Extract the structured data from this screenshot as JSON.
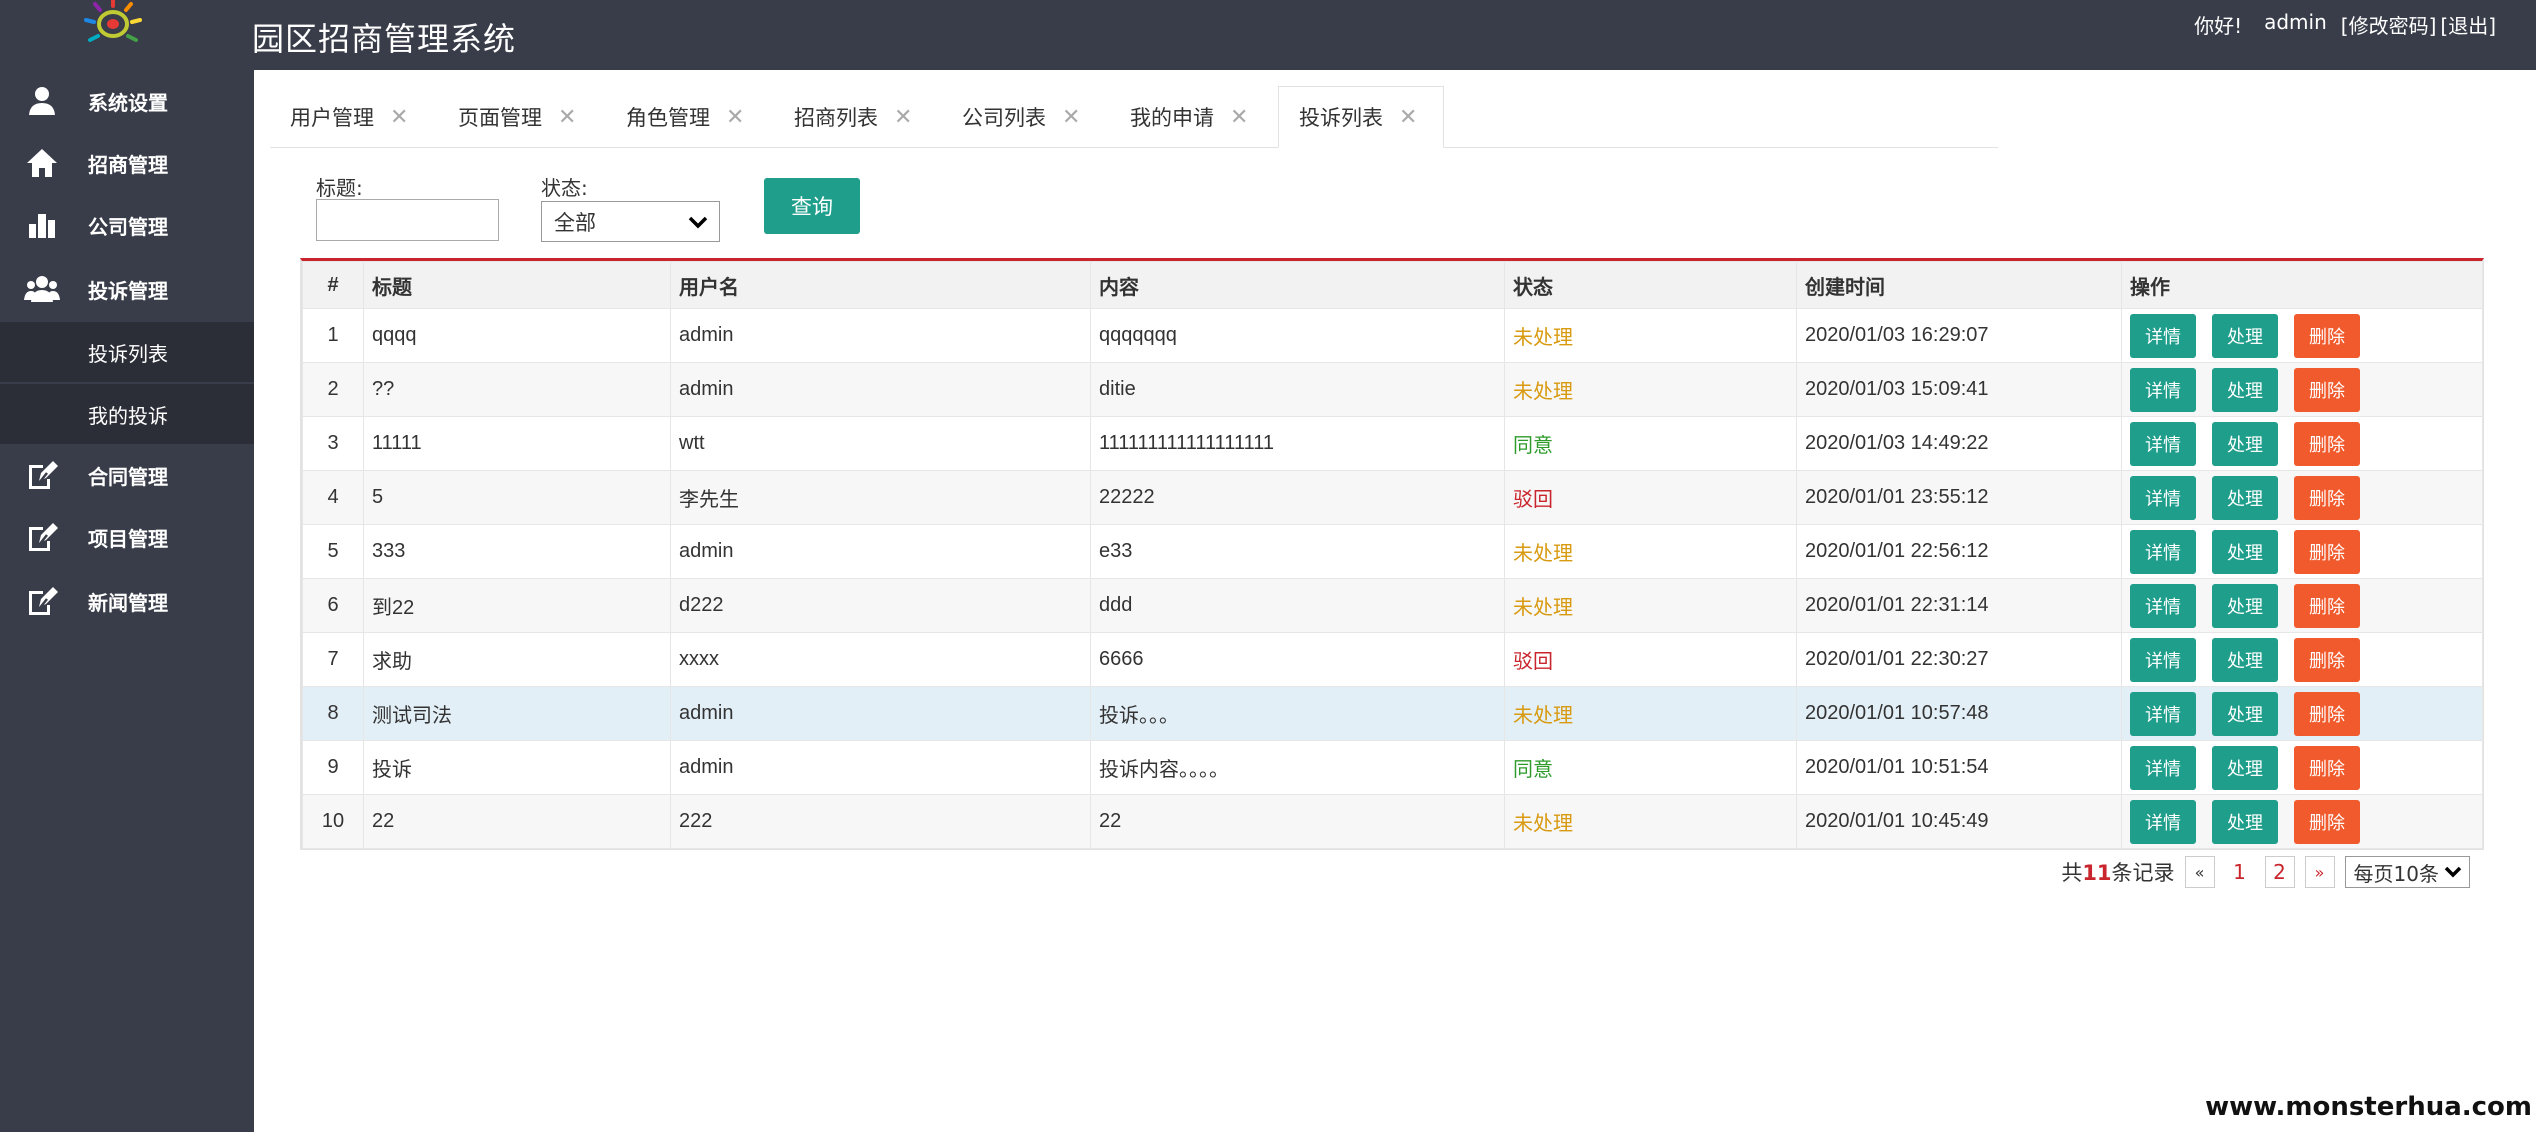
{
  "header": {
    "title": "园区招商管理系统",
    "greeting": "你好!",
    "username": "admin",
    "change_password": "[修改密码]",
    "logout": "[退出]"
  },
  "sidebar": {
    "items": [
      {
        "label": "系统设置",
        "icon": "user-icon"
      },
      {
        "label": "招商管理",
        "icon": "home-icon"
      },
      {
        "label": "公司管理",
        "icon": "bar-chart-icon"
      },
      {
        "label": "投诉管理",
        "icon": "group-icon"
      },
      {
        "label": "合同管理",
        "icon": "edit-check-icon"
      },
      {
        "label": "项目管理",
        "icon": "edit-check-icon"
      },
      {
        "label": "新闻管理",
        "icon": "edit-check-icon"
      }
    ],
    "subitems": [
      {
        "label": "投诉列表"
      },
      {
        "label": "我的投诉"
      }
    ]
  },
  "tabs": [
    {
      "label": "用户管理"
    },
    {
      "label": "页面管理"
    },
    {
      "label": "角色管理"
    },
    {
      "label": "招商列表"
    },
    {
      "label": "公司列表"
    },
    {
      "label": "我的申请"
    },
    {
      "label": "投诉列表",
      "active": true
    }
  ],
  "filter": {
    "title_label": "标题:",
    "title_value": "",
    "status_label": "状态:",
    "status_value": "全部",
    "query_label": "查询"
  },
  "table": {
    "headers": [
      "#",
      "标题",
      "用户名",
      "内容",
      "状态",
      "创建时间",
      "操作"
    ],
    "rows": [
      {
        "num": "1",
        "title": "qqqq",
        "user": "admin",
        "content": "qqqqqqq",
        "status": "未处理",
        "time": "2020/01/03 16:29:07"
      },
      {
        "num": "2",
        "title": "??",
        "user": "admin",
        "content": "ditie",
        "status": "未处理",
        "time": "2020/01/03 15:09:41"
      },
      {
        "num": "3",
        "title": "11111",
        "user": "wtt",
        "content": "111111111111111111",
        "status": "同意",
        "time": "2020/01/03 14:49:22"
      },
      {
        "num": "4",
        "title": "5",
        "user": "李先生",
        "content": "22222",
        "status": "驳回",
        "time": "2020/01/01 23:55:12"
      },
      {
        "num": "5",
        "title": "333",
        "user": "admin",
        "content": "e33",
        "status": "未处理",
        "time": "2020/01/01 22:56:12"
      },
      {
        "num": "6",
        "title": "到22",
        "user": "d222",
        "content": "ddd",
        "status": "未处理",
        "time": "2020/01/01 22:31:14"
      },
      {
        "num": "7",
        "title": "求助",
        "user": "xxxx",
        "content": "6666",
        "status": "驳回",
        "time": "2020/01/01 22:30:27"
      },
      {
        "num": "8",
        "title": "测试司法",
        "user": "admin",
        "content": "投诉。。。",
        "status": "未处理",
        "time": "2020/01/01 10:57:48"
      },
      {
        "num": "9",
        "title": "投诉",
        "user": "admin",
        "content": "投诉内容。。。。",
        "status": "同意",
        "time": "2020/01/01 10:51:54"
      },
      {
        "num": "10",
        "title": "22",
        "user": "222",
        "content": "22",
        "status": "未处理",
        "time": "2020/01/01 10:45:49"
      }
    ],
    "actions": {
      "detail": "详情",
      "handle": "处理",
      "delete": "删除"
    }
  },
  "pager": {
    "prefix": "共",
    "total": "11",
    "suffix": "条记录",
    "prev": "«",
    "pages": [
      "1",
      "2"
    ],
    "next": "»",
    "page_size": "每页10条"
  },
  "watermark": "www.monsterhua.com",
  "colors": {
    "header_bg": "#393d49",
    "sidebar_active": "#2b2e37",
    "accent_green": "#1e9e8b",
    "danger": "#f15a2c",
    "status_pending": "#d89a10",
    "status_agree": "#2e9b2b",
    "status_reject": "#c9252c"
  }
}
